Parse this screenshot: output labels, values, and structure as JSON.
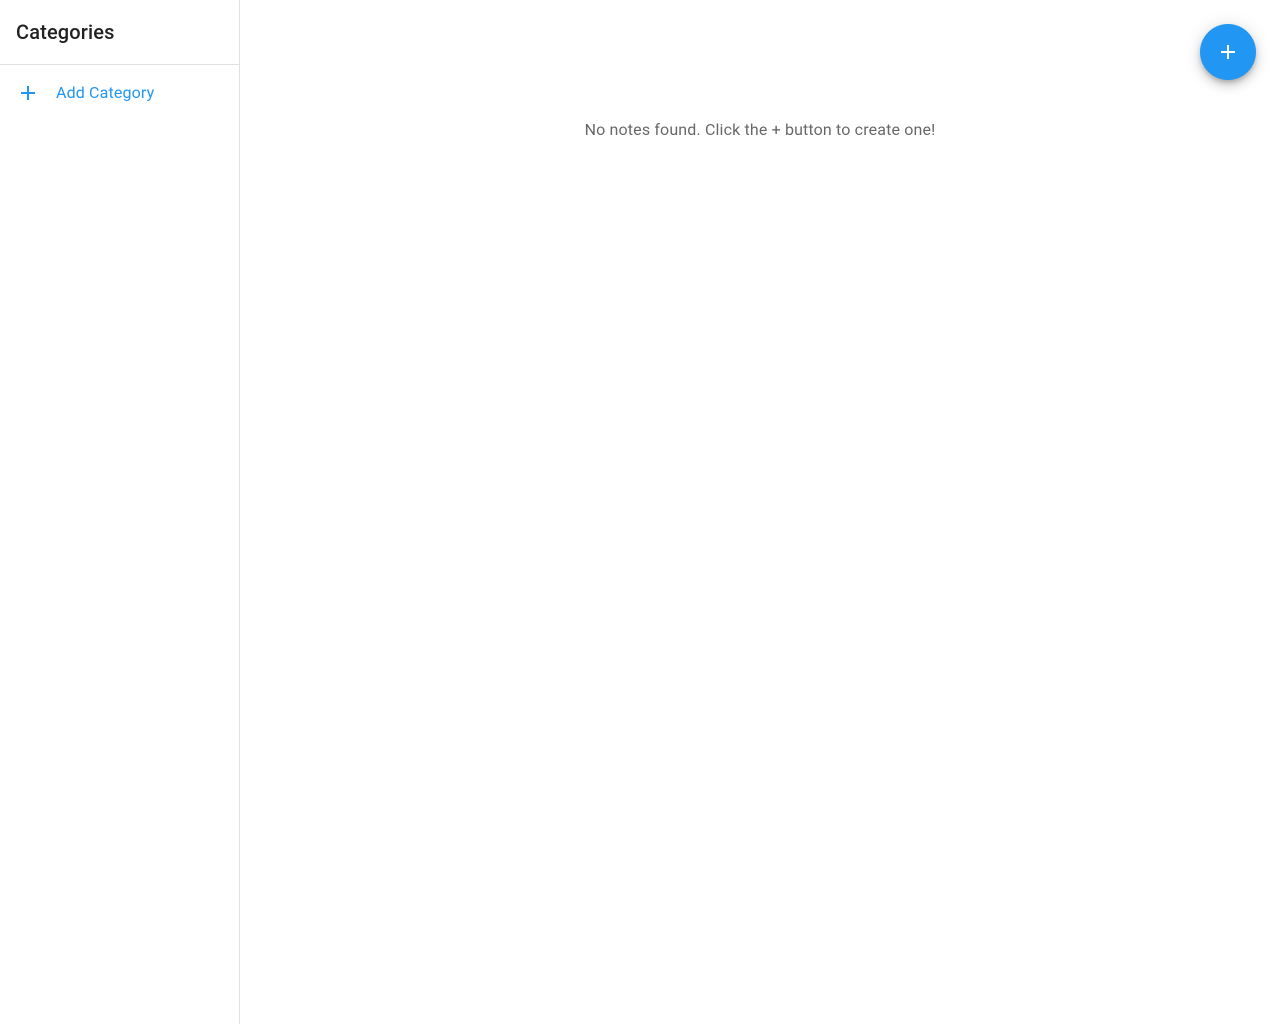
{
  "sidebar": {
    "title": "Categories",
    "add_category_label": "Add Category"
  },
  "main": {
    "empty_message": "No notes found. Click the + button to create one!"
  },
  "colors": {
    "primary": "#2196f3"
  },
  "icons": {
    "plus": "plus-icon"
  }
}
